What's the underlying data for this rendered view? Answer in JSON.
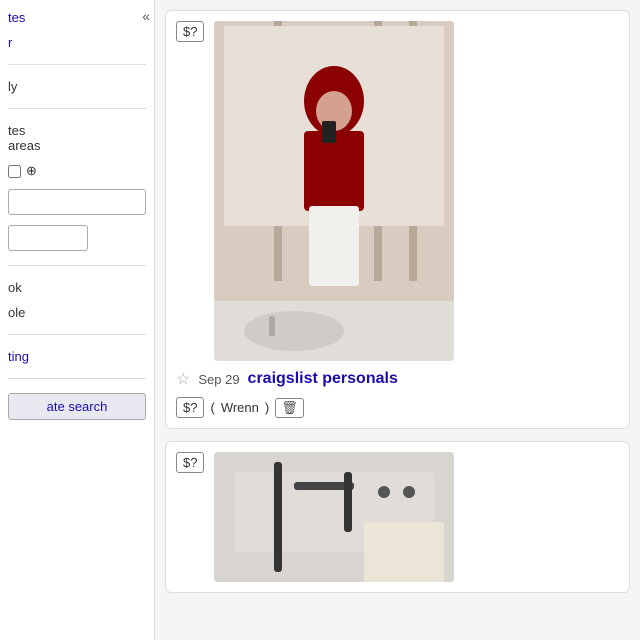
{
  "sidebar": {
    "collapse_icon": "«",
    "links": [
      {
        "label": "tes",
        "id": "link-tes"
      },
      {
        "label": "r",
        "id": "link-r"
      }
    ],
    "filter_only_label": "ly",
    "filter_tes_areas_label": "tes\nareas",
    "location_icon": "⊕",
    "input_placeholder": "",
    "input2_placeholder": "",
    "ok_label": "ok",
    "ole_label": "ole",
    "listing_label": "ting",
    "update_search_label": "ate search"
  },
  "listings": [
    {
      "id": "listing-1",
      "price": "$?",
      "date": "Sep 29",
      "title": "craigslist personals",
      "seller": "Wrenn",
      "has_image": true,
      "image_type": "mirror-selfie"
    },
    {
      "id": "listing-2",
      "price": "$?",
      "date": "",
      "title": "",
      "seller": "",
      "has_image": true,
      "image_type": "bathroom"
    }
  ],
  "icons": {
    "star_empty": "☆",
    "star_filled": "★",
    "delete": "🗑",
    "collapse": "«",
    "location": "⊕"
  }
}
